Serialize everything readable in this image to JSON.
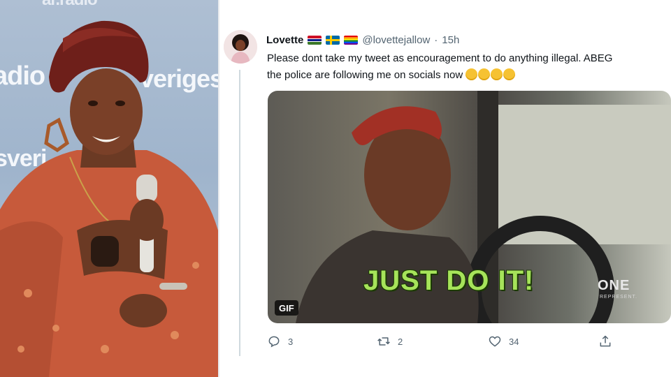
{
  "backdrop": {
    "texts": [
      "adio",
      "veriges",
      "sveri",
      "ar.radio"
    ]
  },
  "tweet": {
    "display_name": "Lovette",
    "flags": [
      "gambia-flag",
      "sweden-flag",
      "rainbow-flag"
    ],
    "handle": "@lovettejallow",
    "separator": "·",
    "time": "15h",
    "text_line1": "Please dont take my tweet as encouragement to do anything illegal. ABEG",
    "text_line2": "the police are following me on socials now",
    "emoji_count": 4,
    "media": {
      "caption": "JUST DO IT!",
      "badge": "GIF",
      "logo": "ONE",
      "logo_sub": "REPRESENT."
    },
    "actions": {
      "replies": "3",
      "retweets": "2",
      "likes": "34"
    }
  },
  "colors": {
    "text_primary": "#0f1419",
    "text_secondary": "#536471",
    "caption_green": "#a6e35a",
    "divider": "#cfd9de"
  }
}
